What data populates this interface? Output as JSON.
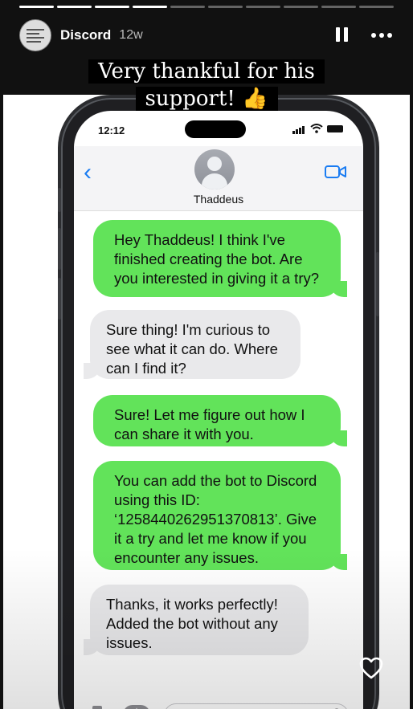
{
  "story": {
    "progress": {
      "total_segments": 10,
      "completed_segments": 4
    },
    "account_name": "Discord",
    "time_ago": "12w",
    "caption_line1": "Very thankful for his",
    "caption_line2": "support! 👍",
    "icons": {
      "pause": "pause-icon",
      "more": "more-icon",
      "like": "heart-icon"
    }
  },
  "phone": {
    "time": "12:12",
    "contact_name": "Thaddeus",
    "messages": [
      {
        "direction": "sent",
        "lines": [
          "Hey Thaddeus! I think I've",
          "finished creating the bot. Are",
          "you interested in giving it a try?"
        ]
      },
      {
        "direction": "received",
        "lines": [
          "Sure thing! I'm curious to",
          "see what it can do. Where",
          "can I find it?"
        ]
      },
      {
        "direction": "sent",
        "lines": [
          "Sure! Let me figure out how I",
          "can share it with you."
        ]
      },
      {
        "direction": "sent",
        "lines": [
          "You can add the bot to Discord",
          "using this ID:",
          "‘1258440262951370813’. Give",
          "it a try and let me know if you",
          "encounter any issues."
        ]
      },
      {
        "direction": "received",
        "lines": [
          "Thanks, it works perfectly!",
          "Added the bot without any",
          "issues."
        ]
      }
    ],
    "colors": {
      "sent": "#62e35a",
      "received": "#e9e9eb",
      "accent": "#1a7cf2"
    }
  }
}
